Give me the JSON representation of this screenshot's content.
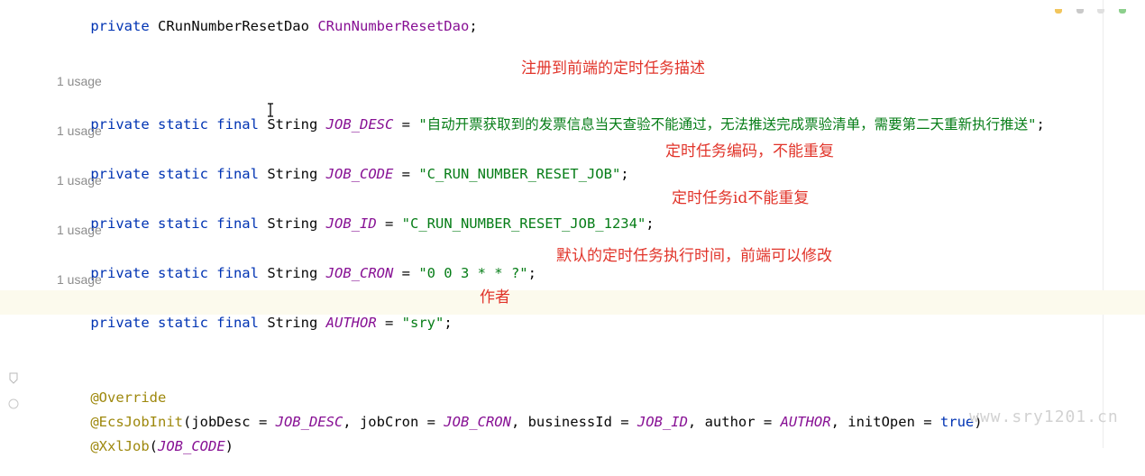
{
  "top_line": {
    "kw": "private",
    "type": "CRunNumberResetDao",
    "name": "CRunNumberResetDao",
    "end": ";"
  },
  "usage_label": "1 usage",
  "modifiers": "private static final",
  "type_string": "String",
  "fields": [
    {
      "name": "JOB_DESC",
      "value": "\"自动开票获取到的发票信息当天查验不能通过，无法推送完成票验清单，需要第二天重新执行推送\""
    },
    {
      "name": "JOB_CODE",
      "value": "\"C_RUN_NUMBER_RESET_JOB\""
    },
    {
      "name": "JOB_ID",
      "value": "\"C_RUN_NUMBER_RESET_JOB_1234\""
    },
    {
      "name": "JOB_CRON",
      "value": "\"0 0 3 * * ?\""
    },
    {
      "name": "AUTHOR",
      "value": "\"sry\""
    }
  ],
  "annotations": {
    "desc_note": "注册到前端的定时任务描述",
    "code_note": "定时任务编码，不能重复",
    "id_note": "定时任务id不能重复",
    "cron_note": "默认的定时任务执行时间，前端可以修改",
    "author_note": "作者"
  },
  "method": {
    "override": "@Override",
    "ecs_anno": "@EcsJobInit",
    "ecs_open": "(jobDesc = ",
    "ecs_desc": "JOB_DESC",
    "ecs_cron_key": ", jobCron = ",
    "ecs_cron": "JOB_CRON",
    "ecs_bid_key": ", businessId = ",
    "ecs_bid": "JOB_ID",
    "ecs_author_key": ", author = ",
    "ecs_author": "AUTHOR",
    "ecs_open_key": ", initOpen = ",
    "ecs_true": "true",
    "ecs_close": ")",
    "xxl_anno": "@XxlJob",
    "xxl_open": "(",
    "xxl_code": "JOB_CODE",
    "xxl_close": ")"
  },
  "watermark": "www.sry1201.cn",
  "colors": {
    "keyword": "#0033b3",
    "field": "#871094",
    "string": "#067d17",
    "annotation": "#9e880d",
    "note": "#e1342a",
    "usage": "#8c8c8c"
  }
}
